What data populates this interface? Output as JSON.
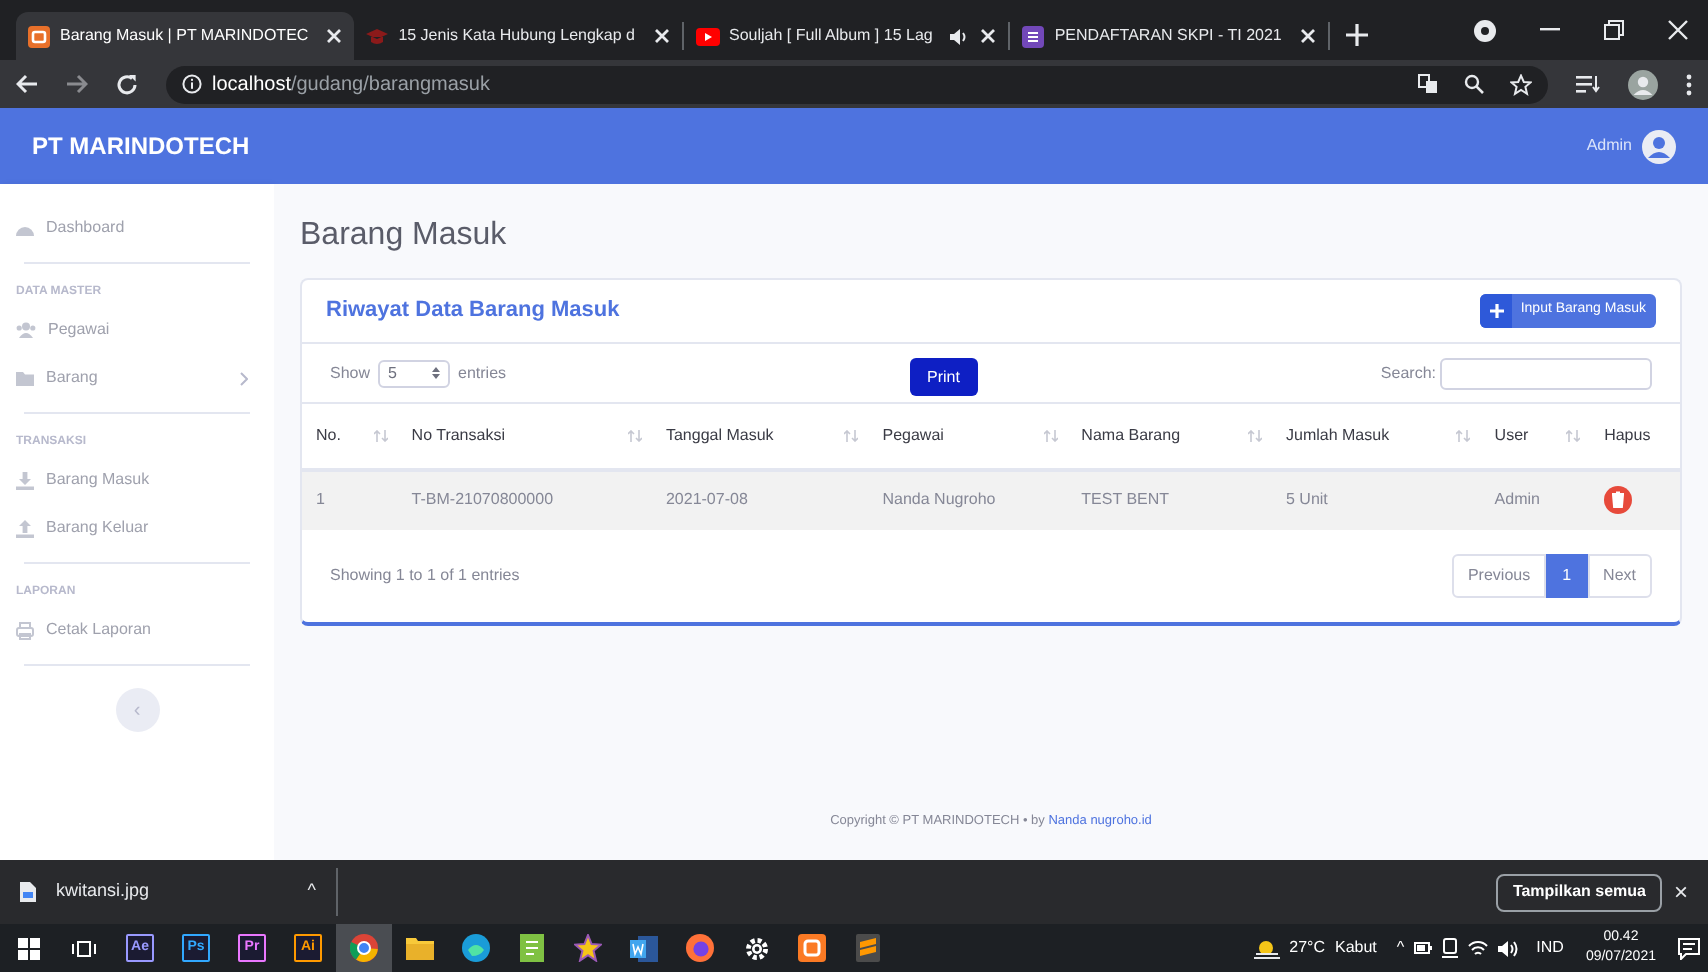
{
  "browser": {
    "tabs": [
      {
        "title": "Barang Masuk | PT MARINDOTEC",
        "audio": false,
        "selected": true
      },
      {
        "title": "15 Jenis Kata Hubung Lengkap d",
        "audio": false,
        "selected": false
      },
      {
        "title": "Souljah [ Full Album ] 15 Lag",
        "audio": true,
        "selected": false
      },
      {
        "title": "PENDAFTARAN SKPI - TI 2021",
        "audio": false,
        "selected": false
      }
    ],
    "address": {
      "host": "localhost",
      "path": "/gudang/barangmasuk"
    }
  },
  "navbar": {
    "brand": "PT MARINDOTECH",
    "user": "Admin"
  },
  "sidebar": {
    "items": [
      {
        "kind": "link",
        "label": "Dashboard",
        "selected": false
      },
      {
        "kind": "heading",
        "label": "DATA MASTER"
      },
      {
        "kind": "link",
        "label": "Pegawai",
        "selected": false
      },
      {
        "kind": "link",
        "label": "Barang",
        "selected": false,
        "expandable": true
      },
      {
        "kind": "heading",
        "label": "TRANSAKSI"
      },
      {
        "kind": "link",
        "label": "Barang Masuk",
        "selected": false
      },
      {
        "kind": "link",
        "label": "Barang Keluar",
        "selected": false
      },
      {
        "kind": "heading",
        "label": "LAPORAN"
      },
      {
        "kind": "link",
        "label": "Cetak Laporan",
        "selected": false
      }
    ],
    "toggle": "‹"
  },
  "page": {
    "title": "Barang Masuk",
    "card": {
      "title": "Riwayat Data Barang Masuk",
      "add_button": "Input Barang Masuk",
      "length": {
        "before": "Show",
        "value": "5",
        "after": "entries"
      },
      "print_button": "Print",
      "search_label": "Search:",
      "table": {
        "columns": [
          {
            "label": "No.",
            "sortable": true
          },
          {
            "label": "No Transaksi",
            "sortable": true
          },
          {
            "label": "Tanggal Masuk",
            "sortable": true
          },
          {
            "label": "Pegawai",
            "sortable": true
          },
          {
            "label": "Nama Barang",
            "sortable": true
          },
          {
            "label": "Jumlah Masuk",
            "sortable": true
          },
          {
            "label": "User",
            "sortable": true
          },
          {
            "label": "Hapus",
            "sortable": false
          }
        ],
        "rows": [
          [
            "1",
            "T-BM-21070800000",
            "2021-07-08",
            "Nanda Nugroho",
            "TEST BENT",
            "5 Unit",
            "Admin"
          ]
        ]
      },
      "info": "Showing 1 to 1 of 1 entries",
      "pagination": [
        {
          "label": "Previous",
          "selected": false
        },
        {
          "label": "1",
          "selected": true
        },
        {
          "label": "Next",
          "selected": false
        }
      ]
    },
    "footer": {
      "text": "Copyright © PT MARINDOTECH • by",
      "link": "Nanda nugroho.id"
    }
  },
  "downloads": {
    "file": "kwitansi.jpg",
    "caret": "^",
    "show_all": "Tampilkan semua",
    "close": "×"
  },
  "taskbar": {
    "apps": [
      {
        "kind": "start",
        "selected": false
      },
      {
        "kind": "taskview",
        "selected": false
      },
      {
        "kind": "badge",
        "label": "Ae",
        "color": "#9999ff",
        "selected": false
      },
      {
        "kind": "badge",
        "label": "Ps",
        "color": "#31a8ff",
        "selected": false
      },
      {
        "kind": "badge",
        "label": "Pr",
        "color": "#ea77ff",
        "selected": false
      },
      {
        "kind": "badge",
        "label": "Ai",
        "color": "#ff9a00",
        "selected": false
      },
      {
        "kind": "chrome",
        "selected": true
      },
      {
        "kind": "folder",
        "selected": false
      },
      {
        "kind": "edge",
        "selected": false
      },
      {
        "kind": "notepad",
        "selected": false
      },
      {
        "kind": "star",
        "selected": false
      },
      {
        "kind": "word",
        "selected": false
      },
      {
        "kind": "firefox",
        "selected": false
      },
      {
        "kind": "gear",
        "selected": false
      },
      {
        "kind": "xampp",
        "selected": false
      },
      {
        "kind": "sublime",
        "selected": false
      }
    ],
    "weather": {
      "temp": "27°C",
      "desc": "Kabut"
    },
    "caret": "^",
    "language": "IND",
    "time": "00.42",
    "date": "09/07/2021"
  }
}
